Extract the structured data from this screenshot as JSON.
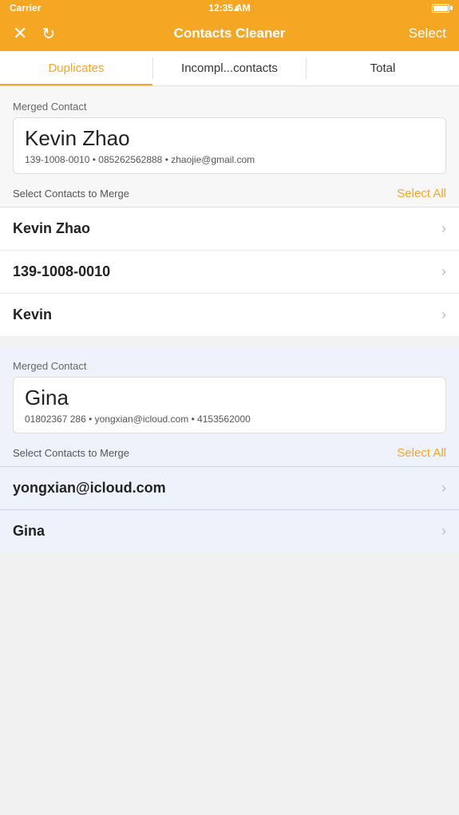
{
  "statusBar": {
    "carrier": "Carrier",
    "time": "12:35 AM",
    "wifi": true,
    "battery": true
  },
  "navBar": {
    "title": "Contacts Cleaner",
    "selectLabel": "Select",
    "closeIcon": "✕",
    "refreshIcon": "↻"
  },
  "tabs": [
    {
      "label": "Duplicates",
      "active": true
    },
    {
      "label": "Incompl...contacts",
      "active": false
    },
    {
      "label": "Total",
      "active": false
    }
  ],
  "sections": [
    {
      "id": "section-1",
      "highlighted": false,
      "mergedContactLabel": "Merged Contact",
      "mergedName": "Kevin Zhao",
      "mergedDetails": "139-1008-0010 • 085262562888 • zhaojie@gmail.com",
      "selectContactsLabel": "Select Contacts to Merge",
      "selectAllLabel": "Select All",
      "contacts": [
        {
          "name": "Kevin Zhao"
        },
        {
          "name": "139-1008-0010"
        },
        {
          "name": "Kevin"
        }
      ]
    },
    {
      "id": "section-2",
      "highlighted": true,
      "mergedContactLabel": "Merged Contact",
      "mergedName": "Gina",
      "mergedDetails": "01802367 286 • yongxian@icloud.com • 4153562000",
      "selectContactsLabel": "Select Contacts to Merge",
      "selectAllLabel": "Select All",
      "contacts": [
        {
          "name": "yongxian@icloud.com"
        },
        {
          "name": "Gina"
        }
      ]
    }
  ]
}
